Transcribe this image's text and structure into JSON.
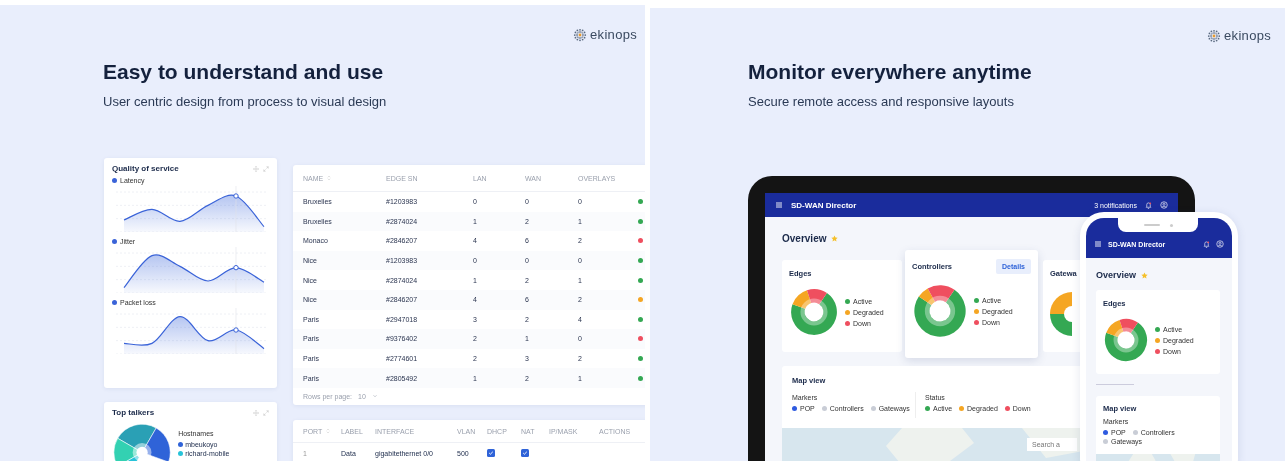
{
  "left": {
    "logo": "ekinops",
    "title": "Easy to understand and use",
    "subtitle": "User centric design from process to visual design",
    "qos": {
      "title": "Quality of service",
      "charts": [
        {
          "label": "Latency"
        },
        {
          "label": "Jitter"
        },
        {
          "label": "Packet loss"
        }
      ]
    },
    "top_talkers": {
      "title": "Top talkers",
      "legend_title": "Hostnames",
      "legend": [
        {
          "label": "mbeukoyo",
          "color": "#2f63d8"
        },
        {
          "label": "richard-mobile",
          "color": "#27c3d9"
        }
      ]
    },
    "edges_table": {
      "columns": [
        "NAME",
        "EDGE SN",
        "LAN",
        "WAN",
        "OVERLAYS"
      ],
      "rows": [
        {
          "name": "Bruxelles",
          "sn": "#1203983",
          "lan": "0",
          "wan": "0",
          "overlays": "0",
          "color": "#34a853"
        },
        {
          "name": "Bruxelles",
          "sn": "#2874024",
          "lan": "1",
          "wan": "2",
          "overlays": "1",
          "color": "#34a853"
        },
        {
          "name": "Monaco",
          "sn": "#2846207",
          "lan": "4",
          "wan": "6",
          "overlays": "2",
          "color": "#ef4f5f"
        },
        {
          "name": "Nice",
          "sn": "#1203983",
          "lan": "0",
          "wan": "0",
          "overlays": "0",
          "color": "#34a853"
        },
        {
          "name": "Nice",
          "sn": "#2874024",
          "lan": "1",
          "wan": "2",
          "overlays": "1",
          "color": "#34a853"
        },
        {
          "name": "Nice",
          "sn": "#2846207",
          "lan": "4",
          "wan": "6",
          "overlays": "2",
          "color": "#f5a623"
        },
        {
          "name": "Paris",
          "sn": "#2947018",
          "lan": "3",
          "wan": "2",
          "overlays": "4",
          "color": "#34a853"
        },
        {
          "name": "Paris",
          "sn": "#9376402",
          "lan": "2",
          "wan": "1",
          "overlays": "0",
          "color": "#ef4f5f"
        },
        {
          "name": "Paris",
          "sn": "#2774601",
          "lan": "2",
          "wan": "3",
          "overlays": "2",
          "color": "#34a853"
        },
        {
          "name": "Paris",
          "sn": "#2805492",
          "lan": "1",
          "wan": "2",
          "overlays": "1",
          "color": "#34a853"
        }
      ],
      "rows_per_page_label": "Rows per page:",
      "rows_per_page": "10"
    },
    "ports_table": {
      "columns": [
        "PORT",
        "LABEL",
        "INTERFACE",
        "VLAN",
        "DHCP",
        "NAT",
        "IP/MASK",
        "ACTIONS"
      ],
      "rows": [
        {
          "port": "1",
          "label": "Data",
          "interface": "gigabitethernet 0/0",
          "vlan": "500",
          "dhcp": true,
          "nat": true
        }
      ]
    }
  },
  "right": {
    "logo": "ekinops",
    "title": "Monitor everywhere anytime",
    "subtitle": "Secure remote access and responsive layouts",
    "tablet": {
      "app_title": "SD-WAN Director",
      "notifications": "3 notifications",
      "page_title": "Overview",
      "cards": [
        {
          "kind": "full",
          "title": "Edges",
          "legend": [
            {
              "label": "Active",
              "color": "#34a853"
            },
            {
              "label": "Degraded",
              "color": "#f5a623"
            },
            {
              "label": "Down",
              "color": "#ef4f5f"
            }
          ]
        },
        {
          "kind": "full",
          "title": "Controllers",
          "action": "Details",
          "legend": [
            {
              "label": "Active",
              "color": "#34a853"
            },
            {
              "label": "Degraded",
              "color": "#f5a623"
            },
            {
              "label": "Down",
              "color": "#ef4f5f"
            }
          ]
        },
        {
          "kind": "cut",
          "title": "Gatewa"
        }
      ],
      "map": {
        "title": "Map view",
        "markers_title": "Markers",
        "markers": [
          {
            "label": "POP",
            "color": "#2f5be0"
          },
          {
            "label": "Controllers",
            "color": "#c9cdd6"
          },
          {
            "label": "Gateways",
            "color": "#c9cdd6"
          }
        ],
        "status_title": "Status",
        "status": [
          {
            "label": "Active",
            "color": "#34a853"
          },
          {
            "label": "Degraded",
            "color": "#f5a623"
          },
          {
            "label": "Down",
            "color": "#ef4f5f"
          }
        ],
        "search_placeholder": "Search a"
      }
    },
    "phone": {
      "app_title": "SD-WAN Director",
      "page_title": "Overview",
      "card": {
        "kind": "full",
        "title": "Edges",
        "legend": [
          {
            "label": "Active",
            "color": "#34a853"
          },
          {
            "label": "Degraded",
            "color": "#f5a623"
          },
          {
            "label": "Down",
            "color": "#ef4f5f"
          }
        ]
      },
      "map": {
        "title": "Map view",
        "markers_title": "Markers",
        "markers": [
          {
            "label": "POP",
            "color": "#2f5be0"
          },
          {
            "label": "Controllers",
            "color": "#c9cdd6"
          },
          {
            "label": "Gateways",
            "color": "#c9cdd6"
          }
        ]
      }
    }
  }
}
